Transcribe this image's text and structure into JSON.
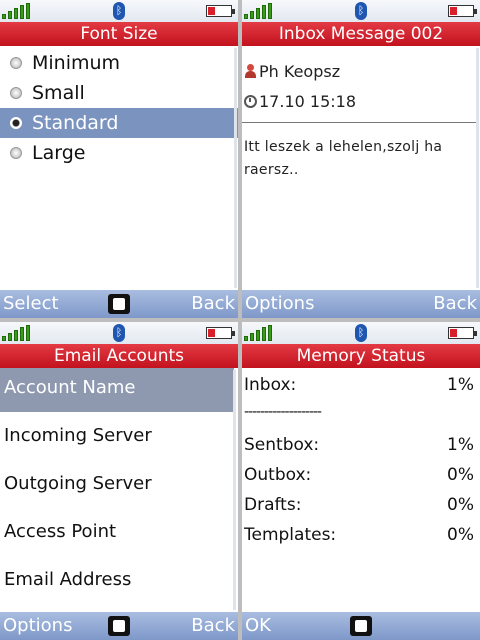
{
  "font_size_screen": {
    "title": "Font Size",
    "options": [
      {
        "label": "Minimum",
        "selected": false
      },
      {
        "label": "Small",
        "selected": false
      },
      {
        "label": "Standard",
        "selected": true
      },
      {
        "label": "Large",
        "selected": false
      }
    ],
    "softkeys": {
      "left": "Select",
      "right": "Back"
    }
  },
  "inbox_screen": {
    "title": "Inbox Message 002",
    "sender": "Ph Keopsz",
    "datetime": "17.10 15:18",
    "body": "Itt leszek a lehelen,szolj ha raersz..",
    "softkeys": {
      "left": "Options",
      "right": "Back"
    }
  },
  "email_accounts_screen": {
    "title": "Email Accounts",
    "items": [
      {
        "label": "Account Name",
        "selected": true
      },
      {
        "label": "Incoming Server",
        "selected": false
      },
      {
        "label": "Outgoing Server",
        "selected": false
      },
      {
        "label": "Access Point",
        "selected": false
      },
      {
        "label": "Email Address",
        "selected": false
      }
    ],
    "softkeys": {
      "left": "Options",
      "right": "Back"
    }
  },
  "memory_status_screen": {
    "title": "Memory Status",
    "inbox": {
      "label": "Inbox:",
      "value": "1%"
    },
    "separator": "-------------------",
    "rows": [
      {
        "label": "Sentbox:",
        "value": "1%"
      },
      {
        "label": "Outbox:",
        "value": "0%"
      },
      {
        "label": "Drafts:",
        "value": "0%"
      },
      {
        "label": "Templates:",
        "value": "0%"
      }
    ],
    "softkeys": {
      "left": "OK",
      "right": ""
    }
  },
  "icons": {
    "signal": "signal-strength-icon",
    "bluetooth": "bluetooth-icon",
    "battery": "battery-icon",
    "center_key": "center-key-icon"
  },
  "colors": {
    "title_bar": "#d42230",
    "softkey_bar": "#8da6d4",
    "selection": "#7b93bf"
  }
}
